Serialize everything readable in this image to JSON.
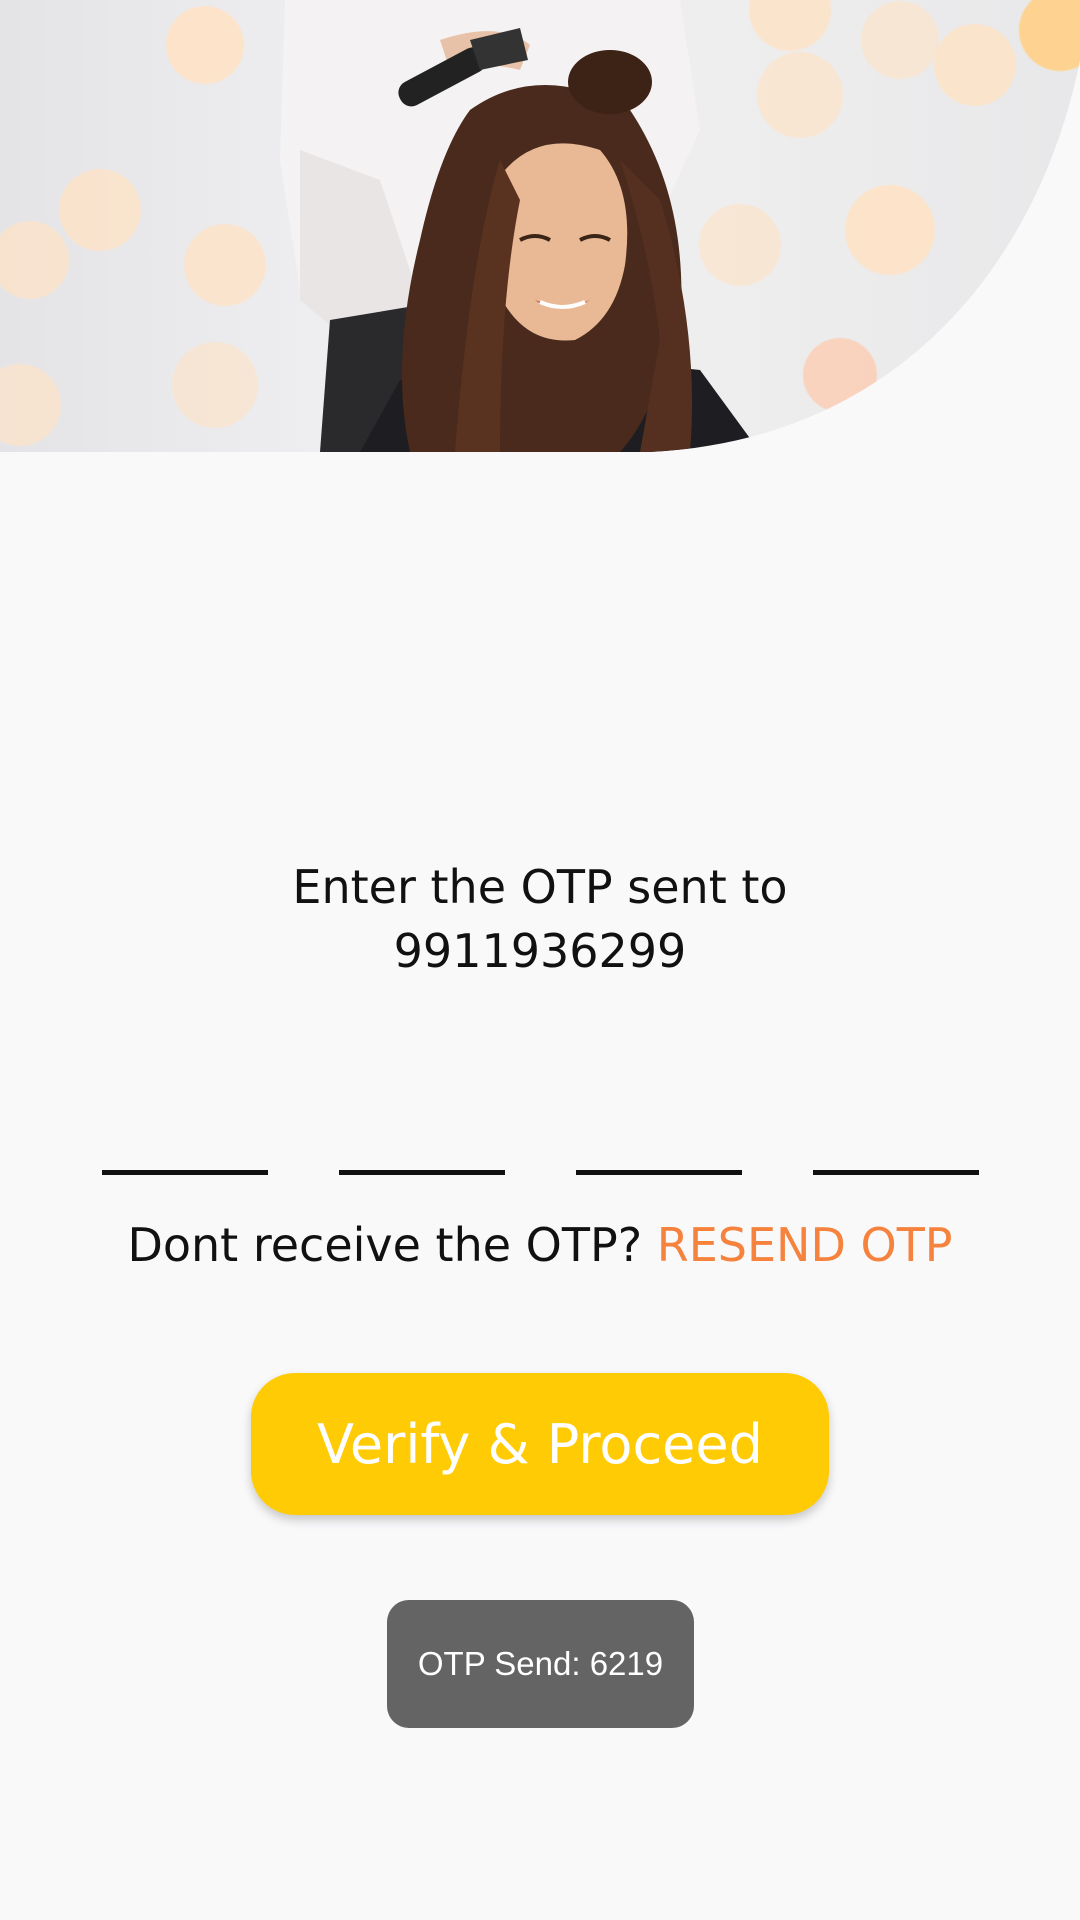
{
  "hero": {
    "image_alt": "Hairdresser styling a smiling woman's hair in a salon"
  },
  "prompt": {
    "line1": "Enter the OTP sent to",
    "phone": "9911936299"
  },
  "otp": {
    "digits": [
      "",
      "",
      "",
      ""
    ]
  },
  "resend": {
    "question": "Dont receive the OTP?",
    "link_label": "RESEND OTP",
    "link_color": "#f5833e"
  },
  "verify_button": {
    "label": "Verify & Proceed",
    "color": "#ffcb05"
  },
  "toast": {
    "message": "OTP Send: 6219"
  }
}
